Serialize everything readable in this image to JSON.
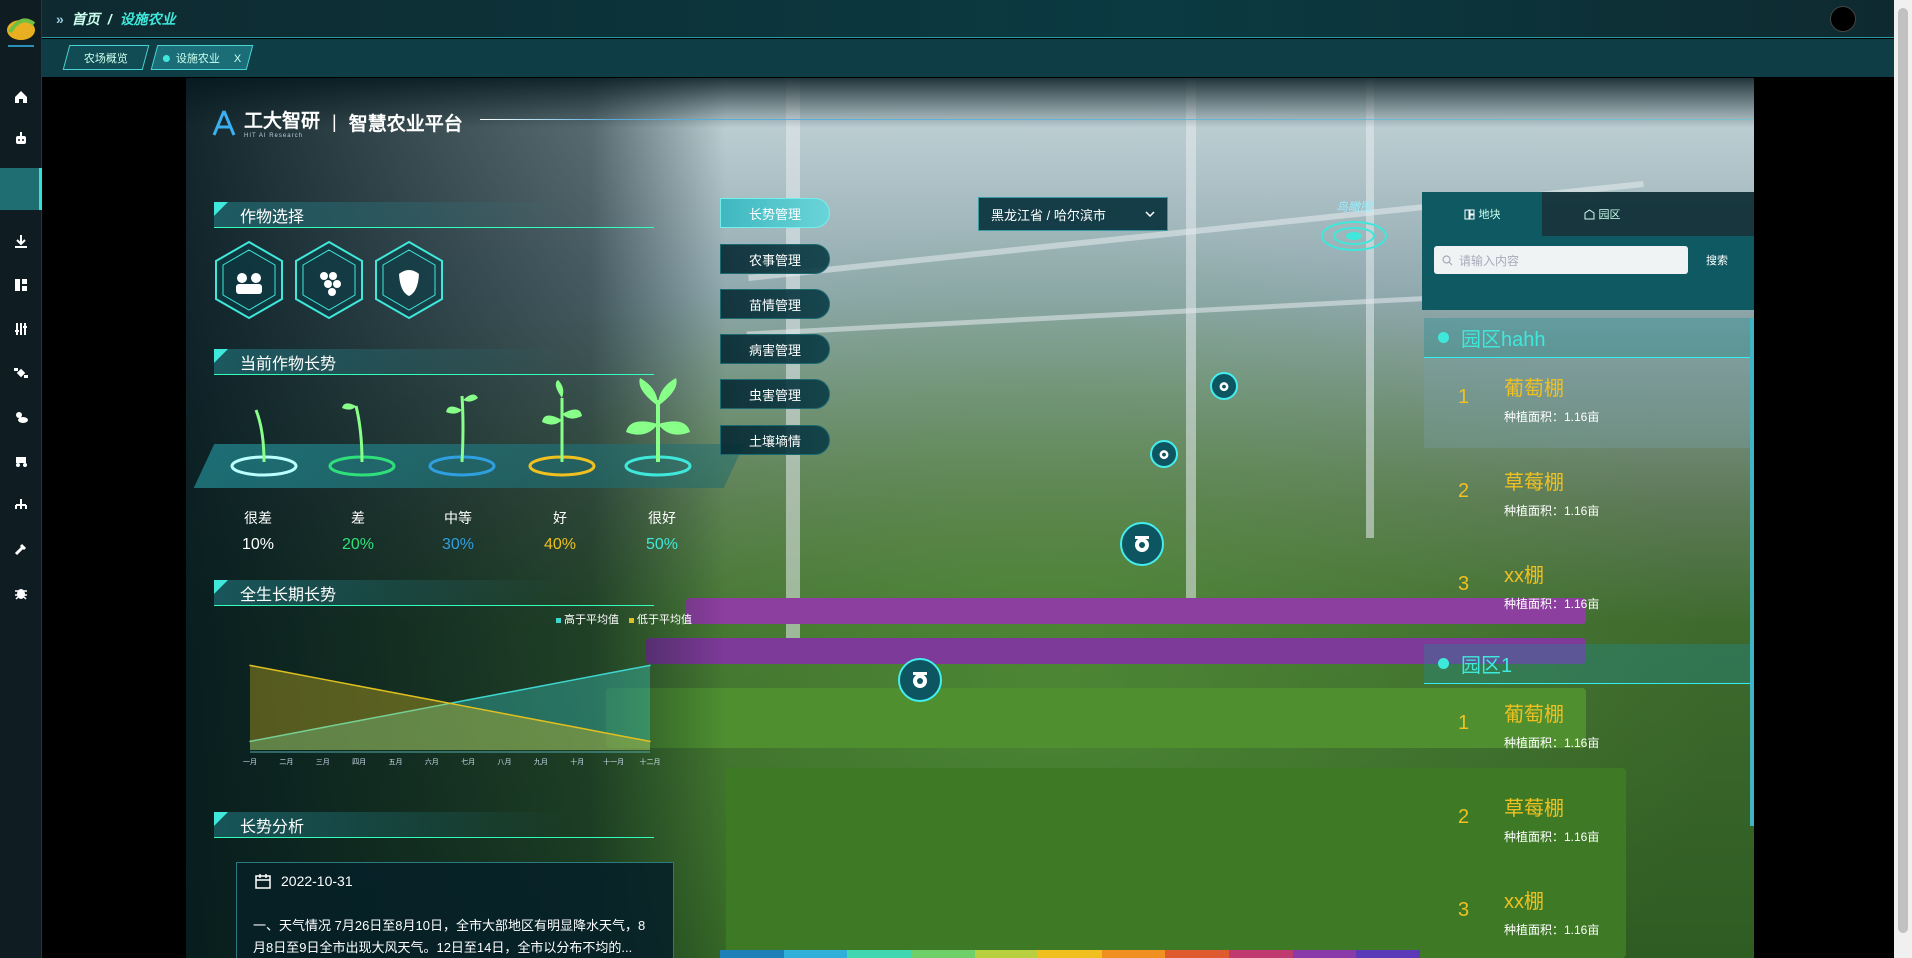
{
  "breadcrumb": {
    "home": "首页",
    "sep": "/",
    "current": "设施农业"
  },
  "tabs": [
    {
      "label": "农场概览"
    },
    {
      "label": "设施农业",
      "close": "X"
    }
  ],
  "brand": {
    "name": "工大智研",
    "english": "HIT AI Research",
    "sep": "|",
    "platform": "智慧农业平台"
  },
  "sections": {
    "crop_select": "作物选择",
    "current_growth": "当前作物长势",
    "full_growth": "全生长期长势",
    "analysis": "长势分析"
  },
  "growth_levels": [
    {
      "label": "很差",
      "value": "10%",
      "color": "#ffffff"
    },
    {
      "label": "差",
      "value": "20%",
      "color": "#2fe07a"
    },
    {
      "label": "中等",
      "value": "30%",
      "color": "#2f9fe0"
    },
    {
      "label": "好",
      "value": "40%",
      "color": "#f0c020"
    },
    {
      "label": "很好",
      "value": "50%",
      "color": "#3fe8da"
    }
  ],
  "chart_data": {
    "type": "area",
    "categories": [
      "一月",
      "二月",
      "三月",
      "四月",
      "五月",
      "六月",
      "七月",
      "八月",
      "九月",
      "十月",
      "十一月",
      "十二月"
    ],
    "series": [
      {
        "name": "高于平均值",
        "color": "#3fd6d0",
        "values": [
          5,
          9,
          13,
          17,
          21,
          25,
          29,
          33,
          37,
          41,
          45,
          49
        ]
      },
      {
        "name": "低于平均值",
        "color": "#e0c020",
        "values": [
          49,
          45,
          41,
          37,
          33,
          29,
          25,
          21,
          17,
          13,
          9,
          5
        ]
      }
    ],
    "ylim": [
      0,
      55
    ]
  },
  "report": {
    "date": "2022-10-31",
    "text": "一、天气情况 7月26日至8月10日，全市大部地区有明显降水天气，8月8日至9日全市出现大风天气。12日至14日，全市以分布不均的..."
  },
  "management": [
    "长势管理",
    "农事管理",
    "苗情管理",
    "病害管理",
    "虫害管理",
    "土壤墒情"
  ],
  "region": "黑龙江省 / 哈尔滨市",
  "birdview": "鸟瞰图",
  "side_panel": {
    "tabs": [
      "地块",
      "园区"
    ],
    "search_placeholder": "请输入内容",
    "search_button": "搜索",
    "parks": [
      {
        "name": "园区hahh",
        "sheds": [
          {
            "num": "1",
            "name": "葡萄棚",
            "area": "种植面积：1.16亩"
          },
          {
            "num": "2",
            "name": "草莓棚",
            "area": "种植面积：1.16亩"
          },
          {
            "num": "3",
            "name": "xx棚",
            "area": "种植面积：1.16亩"
          }
        ]
      },
      {
        "name": "园区1",
        "sheds": [
          {
            "num": "1",
            "name": "葡萄棚",
            "area": "种植面积：1.16亩"
          },
          {
            "num": "2",
            "name": "草莓棚",
            "area": "种植面积：1.16亩"
          },
          {
            "num": "3",
            "name": "xx棚",
            "area": "种植面积：1.16亩"
          }
        ]
      }
    ]
  },
  "colors": {
    "accent": "#3fe8da",
    "panel": "#0f5963",
    "gold": "#f0c020"
  }
}
